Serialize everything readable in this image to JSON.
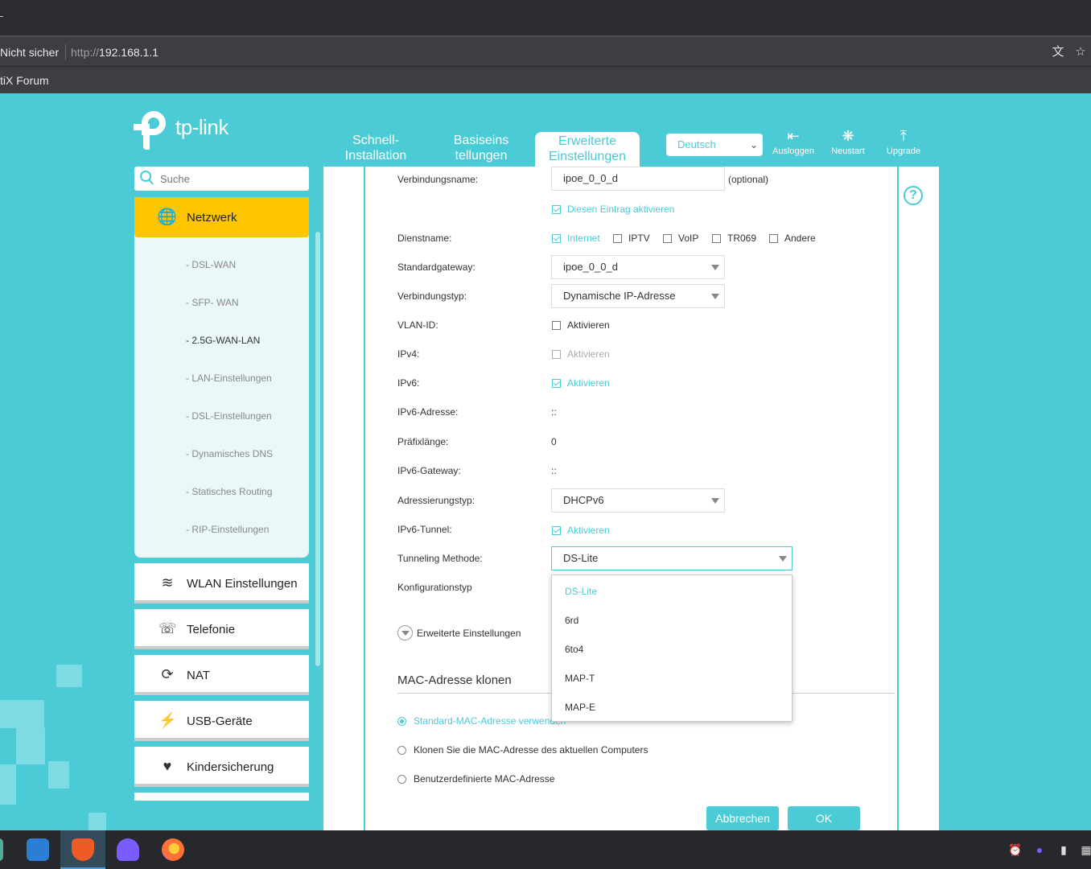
{
  "browser": {
    "security_label": "Nicht sicher",
    "url_proto": "http://",
    "url_host": "192.168.1.1",
    "bookmark": "tiX Forum"
  },
  "header": {
    "logo_text": "tp-link",
    "tabs": [
      {
        "line1": "Schnell-",
        "line2": "Installation"
      },
      {
        "line1": "Basiseins",
        "line2": "tellungen"
      },
      {
        "line1": "Erweiterte",
        "line2": "Einstellungen"
      }
    ],
    "language": "Deutsch",
    "logout": "Ausloggen",
    "restart": "Neustart",
    "upgrade": "Upgrade"
  },
  "sidebar": {
    "search_placeholder": "Suche",
    "network": "Netzwerk",
    "subitems": [
      "- DSL-WAN",
      "- SFP- WAN",
      "- 2.5G-WAN-LAN",
      "- LAN-Einstellungen",
      "- DSL-Einstellungen",
      "- Dynamisches DNS",
      "- Statisches Routing",
      "- RIP-Einstellungen"
    ],
    "items": [
      "WLAN Einstellungen",
      "Telefonie",
      "NAT",
      "USB-Geräte",
      "Kindersicherung"
    ]
  },
  "form": {
    "conn_name_label": "Verbindungsname:",
    "conn_name_value": "ipoe_0_0_d",
    "optional": "(optional)",
    "enable_entry": "Diesen Eintrag aktivieren",
    "service_label": "Dienstname:",
    "services": [
      "Internet",
      "IPTV",
      "VoIP",
      "TR069",
      "Andere"
    ],
    "gateway_label": "Standardgateway:",
    "gateway_value": "ipoe_0_0_d",
    "conntype_label": "Verbindungstyp:",
    "conntype_value": "Dynamische IP-Adresse",
    "vlan_label": "VLAN-ID:",
    "activate": "Aktivieren",
    "ipv4_label": "IPv4:",
    "ipv6_label": "IPv6:",
    "ipv6_addr_label": "IPv6-Adresse:",
    "ipv6_addr_value": "::",
    "prefix_label": "Präfixlänge:",
    "prefix_value": "0",
    "ipv6_gw_label": "IPv6-Gateway:",
    "ipv6_gw_value": "::",
    "addr_type_label": "Adressierungstyp:",
    "addr_type_value": "DHCPv6",
    "tunnel_label": "IPv6-Tunnel:",
    "tunnel_method_label": "Tunneling Methode:",
    "tunnel_method_value": "DS-Lite",
    "config_type_label": "Konfigurationstyp",
    "advanced": "Erweiterte Einstellungen",
    "mac_title": "MAC-Adresse klonen",
    "mac_options": [
      "Standard-MAC-Adresse verwenden",
      "Klonen Sie die MAC-Adresse des aktuellen Computers",
      "Benutzerdefinierte MAC-Adresse"
    ],
    "cancel": "Abbrechen",
    "ok": "OK"
  },
  "dropdown_options": [
    "DS-Lite",
    "6rd",
    "6to4",
    "MAP-T",
    "MAP-E"
  ],
  "colors": {
    "accent": "#4acbd6",
    "highlight": "#ffc600"
  }
}
